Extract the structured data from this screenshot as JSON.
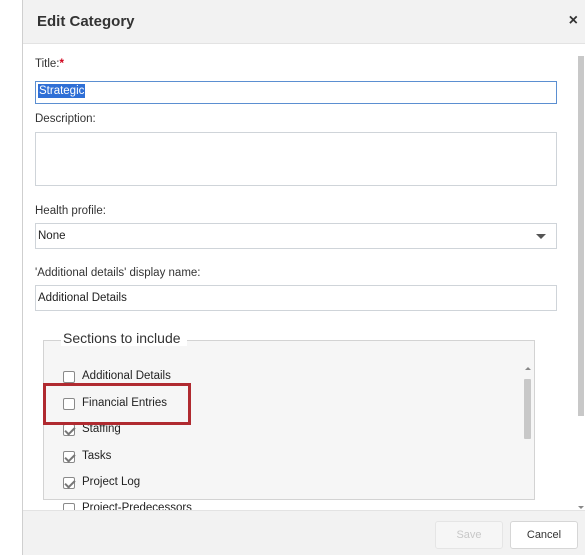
{
  "dialog": {
    "title": "Edit Category",
    "close_symbol": "×"
  },
  "form": {
    "title_label": "Title:",
    "required_mark": "*",
    "title_value": "Strategic",
    "description_label": "Description:",
    "description_value": "",
    "health_label": "Health profile:",
    "health_value": "None",
    "details_label": "'Additional details' display name:",
    "details_value": "Additional Details"
  },
  "sections": {
    "legend": "Sections to include",
    "items": [
      {
        "label": "Additional Details",
        "checked": false
      },
      {
        "label": "Financial Entries",
        "checked": false
      },
      {
        "label": "Staffing",
        "checked": true
      },
      {
        "label": "Tasks",
        "checked": true
      },
      {
        "label": "Project Log",
        "checked": true
      },
      {
        "label": "Project-Predecessors",
        "checked": false
      }
    ]
  },
  "footer": {
    "save_label": "Save",
    "cancel_label": "Cancel"
  },
  "colors": {
    "highlight": "#b02a30",
    "required": "#d0021b",
    "selection": "#2f6fd6"
  },
  "icons": {
    "close": "close-icon",
    "dropdown": "chevron-down-icon",
    "checkbox": "checkbox-icon"
  }
}
